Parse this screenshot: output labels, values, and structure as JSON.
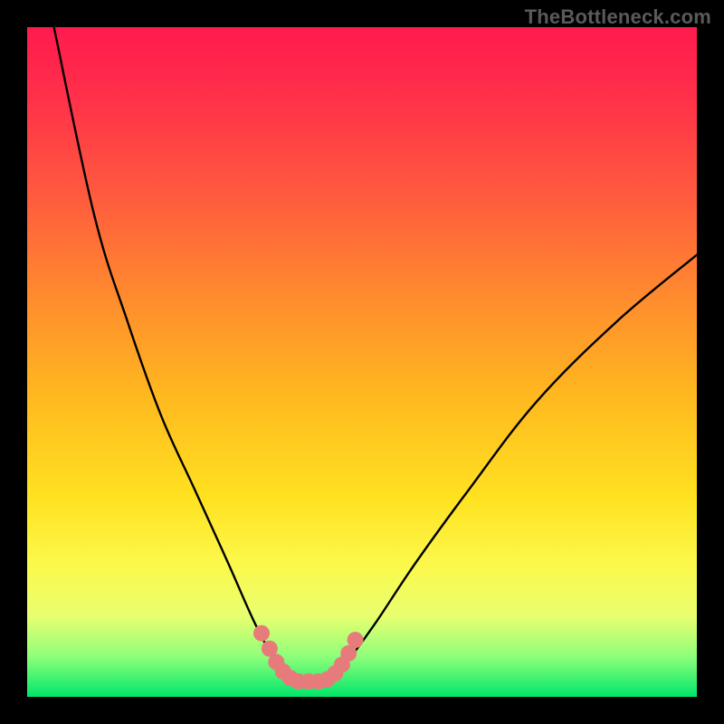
{
  "watermark": "TheBottleneck.com",
  "chart_data": {
    "type": "line",
    "title": "",
    "xlabel": "",
    "ylabel": "",
    "xlim": [
      0,
      100
    ],
    "ylim": [
      0,
      100
    ],
    "grid": false,
    "legend": false,
    "series": [
      {
        "name": "left-branch",
        "x": [
          4,
          10,
          15,
          20,
          25,
          30,
          34,
          37,
          39.5
        ],
        "values": [
          100,
          72,
          56,
          42,
          31,
          20,
          11,
          5.5,
          2.5
        ]
      },
      {
        "name": "right-branch",
        "x": [
          45.5,
          48,
          52,
          58,
          66,
          76,
          88,
          100
        ],
        "values": [
          2.5,
          5.5,
          11,
          20,
          31,
          44,
          56,
          66
        ]
      },
      {
        "name": "trough-flat",
        "x": [
          39.5,
          41,
          43,
          45.5
        ],
        "values": [
          2.5,
          2.3,
          2.3,
          2.5
        ]
      }
    ],
    "markers": {
      "name": "highlight-dots",
      "color": "#e77b7b",
      "points": [
        {
          "x": 35.0,
          "y": 9.5
        },
        {
          "x": 36.2,
          "y": 7.2
        },
        {
          "x": 37.2,
          "y": 5.2
        },
        {
          "x": 38.2,
          "y": 3.8
        },
        {
          "x": 39.3,
          "y": 2.8
        },
        {
          "x": 40.5,
          "y": 2.3
        },
        {
          "x": 42.0,
          "y": 2.3
        },
        {
          "x": 43.5,
          "y": 2.3
        },
        {
          "x": 44.8,
          "y": 2.6
        },
        {
          "x": 46.0,
          "y": 3.5
        },
        {
          "x": 47.0,
          "y": 4.8
        },
        {
          "x": 48.0,
          "y": 6.5
        },
        {
          "x": 49.0,
          "y": 8.5
        }
      ]
    },
    "background_gradient": {
      "top": "#ff1a4e",
      "bottom": "#00e66a"
    }
  }
}
